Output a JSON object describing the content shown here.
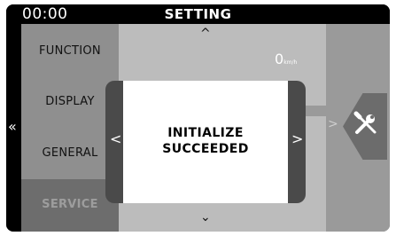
{
  "status": {
    "time": "00:00",
    "title": "SETTING"
  },
  "menu": {
    "items": [
      "FUNCTION",
      "DISPLAY",
      "GENERAL",
      "SERVICE"
    ],
    "selected": "SERVICE"
  },
  "nav": {
    "left": "«",
    "up": "^",
    "down": "⌄",
    "dialog_left": "<",
    "dialog_right": ">",
    "right": ">"
  },
  "readout": {
    "speed_value": "0",
    "speed_unit": "km/h"
  },
  "dialog": {
    "line1": "INITIALIZE",
    "line2": "SUCCEEDED"
  },
  "icons": {
    "tools": "wrench-screwdriver-icon"
  },
  "colors": {
    "background": "#a6a6a6",
    "panel_dark": "#4a4a4a",
    "text_light": "#ffffff"
  }
}
